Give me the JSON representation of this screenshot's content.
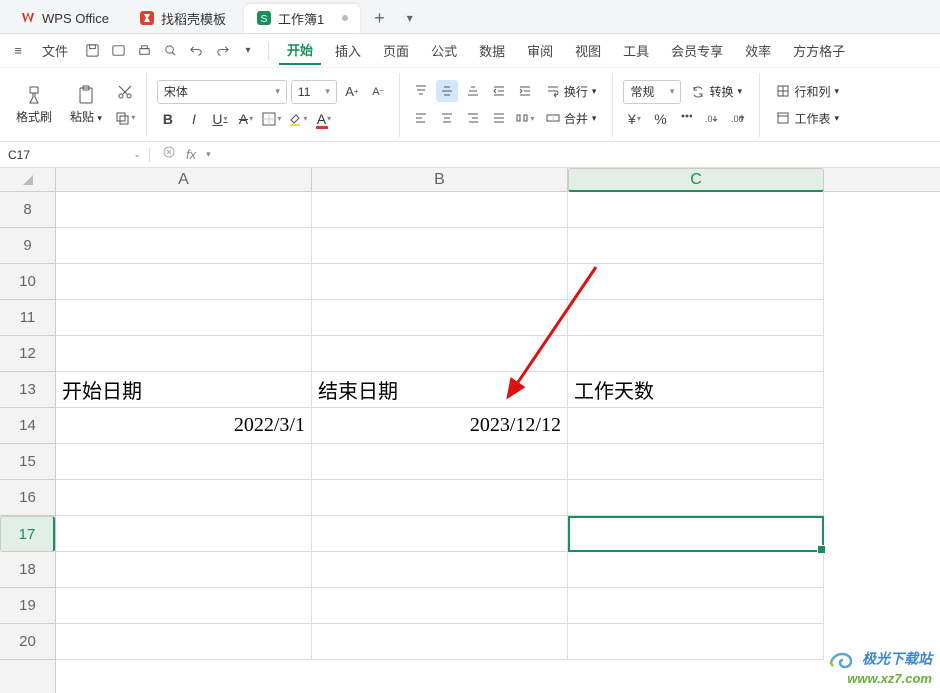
{
  "titlebar": {
    "app": "WPS Office",
    "tabs": [
      {
        "label": "找稻壳模板",
        "icon": "template-icon",
        "active": false
      },
      {
        "label": "工作簿1",
        "icon": "sheet-icon",
        "active": true
      }
    ],
    "add": "+"
  },
  "menubar": {
    "file": "文件",
    "items": [
      "开始",
      "插入",
      "页面",
      "公式",
      "数据",
      "审阅",
      "视图",
      "工具",
      "会员专享",
      "效率",
      "方方格子"
    ],
    "active": "开始"
  },
  "ribbon": {
    "clipboard": {
      "brush": "格式刷",
      "paste": "粘贴"
    },
    "font": {
      "name": "宋体",
      "size": "11",
      "bold": "B",
      "italic": "I",
      "underline": "U",
      "fontcase": "A"
    },
    "align": {
      "wrap": "换行",
      "merge": "合并"
    },
    "number": {
      "format": "常规",
      "convert": "转换"
    },
    "cells": {
      "rowscols": "行和列",
      "worksheet": "工作表"
    }
  },
  "formulabar": {
    "name": "C17",
    "fx": "fx",
    "value": ""
  },
  "grid": {
    "cols": [
      "A",
      "B",
      "C"
    ],
    "rows": [
      "8",
      "9",
      "10",
      "11",
      "12",
      "13",
      "14",
      "15",
      "16",
      "17",
      "18",
      "19",
      "20"
    ],
    "selected": {
      "col": "C",
      "row": "17"
    },
    "data": {
      "r13": {
        "A": "开始日期",
        "B": "结束日期",
        "C": "工作天数"
      },
      "r14": {
        "A": "2022/3/1",
        "B": "2023/12/12",
        "C": ""
      }
    }
  },
  "watermark": {
    "line1": "极光下载站",
    "line2": "www.xz7.com"
  }
}
